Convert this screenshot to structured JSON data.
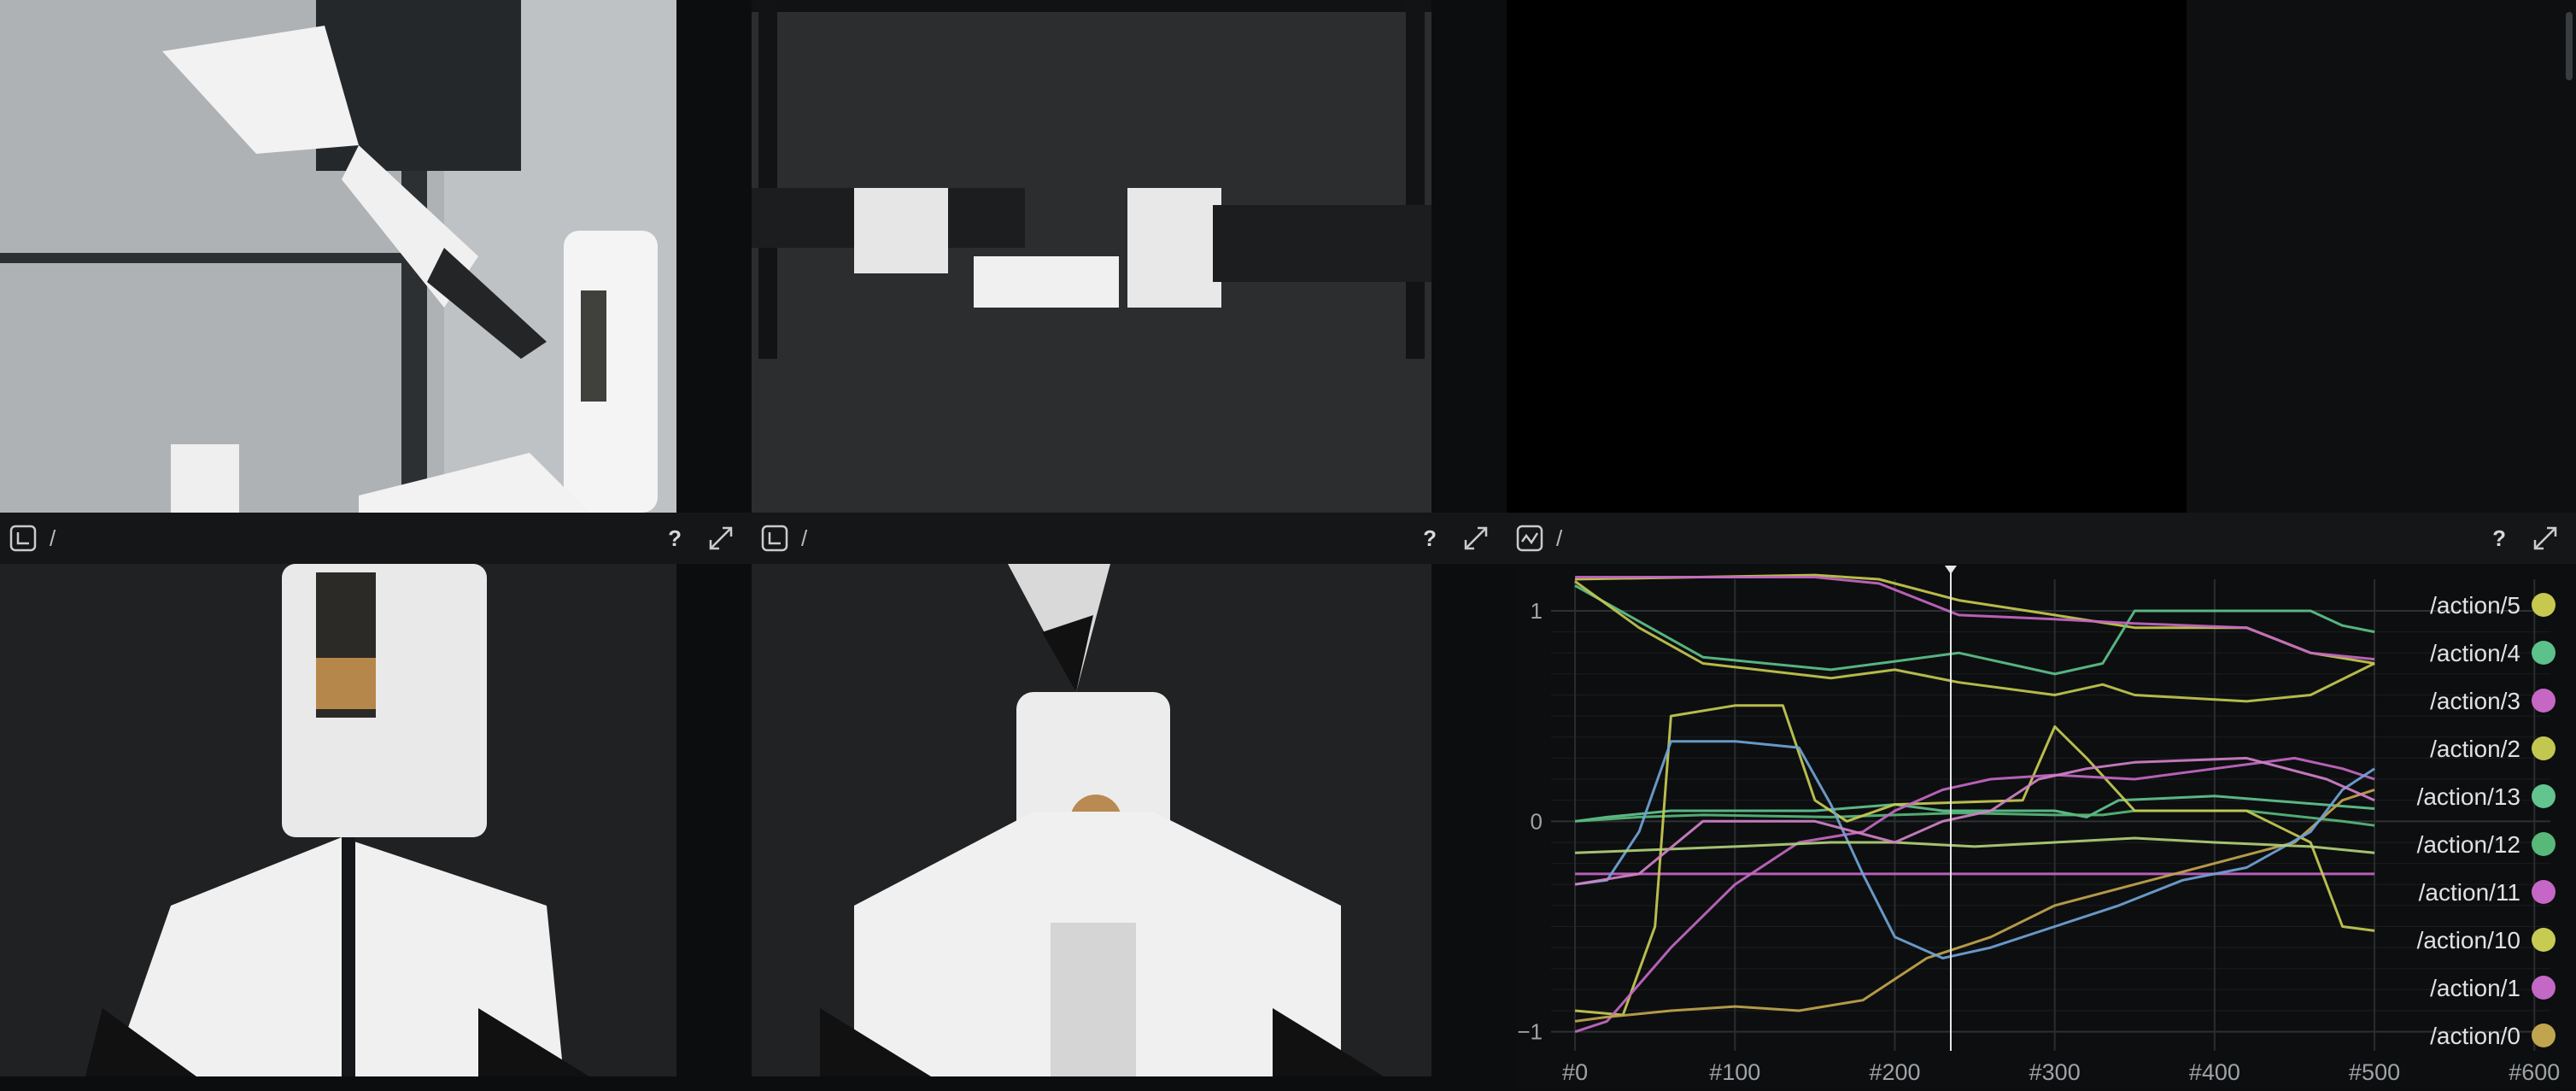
{
  "views": {
    "cam1": {
      "path": "/"
    },
    "cam2": {
      "path": "/"
    },
    "cam3": {
      "path": "/"
    },
    "plot": {
      "path": "/"
    },
    "help": "?"
  },
  "icons": {
    "space_view": "spatial-2d-icon",
    "plot_view": "timeseries-icon",
    "maximize": "maximize-icon"
  },
  "colors": {
    "background": "#0c0d0e",
    "panel_bar": "#141617",
    "plot_bg": "#0d0e0f",
    "time_cursor": "#e8e8e8"
  },
  "chart_data": {
    "type": "line",
    "title": "",
    "xlabel": "",
    "ylabel": "",
    "xlim": [
      -15,
      610
    ],
    "ylim": [
      -1.05,
      1.15
    ],
    "x_ticks": [
      "#0",
      "#100",
      "#200",
      "#300",
      "#400",
      "#500",
      "#600"
    ],
    "x_tick_values": [
      0,
      100,
      200,
      300,
      400,
      500,
      600
    ],
    "y_ticks": [
      "1",
      "0",
      "−1"
    ],
    "y_tick_values": [
      1,
      0,
      -1
    ],
    "time_cursor": 235,
    "grid": true,
    "legend_position": "right",
    "series": [
      {
        "name": "/action/5",
        "color": "#c6c94e",
        "x": [
          0,
          150,
          190,
          240,
          300,
          350,
          420,
          460,
          500
        ],
        "y": [
          1.15,
          1.17,
          1.15,
          1.05,
          0.98,
          0.92,
          0.92,
          0.8,
          0.75
        ]
      },
      {
        "name": "/action/4",
        "color": "#5cc18a",
        "x": [
          0,
          40,
          80,
          160,
          200,
          240,
          300,
          330,
          350,
          460,
          480,
          500
        ],
        "y": [
          1.12,
          0.95,
          0.78,
          0.72,
          0.76,
          0.8,
          0.7,
          0.75,
          1.0,
          1.0,
          0.93,
          0.9
        ]
      },
      {
        "name": "/action/3",
        "color": "#c667c4",
        "x": [
          0,
          150,
          190,
          240,
          300,
          350,
          420,
          460,
          500
        ],
        "y": [
          1.16,
          1.16,
          1.13,
          0.98,
          0.96,
          0.94,
          0.92,
          0.8,
          0.77
        ]
      },
      {
        "name": "/action/2",
        "color": "#c2c84f",
        "x": [
          0,
          40,
          80,
          160,
          200,
          240,
          300,
          330,
          350,
          420,
          460,
          500
        ],
        "y": [
          1.14,
          0.92,
          0.75,
          0.68,
          0.72,
          0.66,
          0.6,
          0.65,
          0.6,
          0.57,
          0.6,
          0.75
        ]
      },
      {
        "name": "/action/13",
        "color": "#62c48f",
        "x": [
          0,
          20,
          60,
          150,
          200,
          230,
          260,
          300,
          320,
          340,
          400,
          500
        ],
        "y": [
          0.0,
          0.02,
          0.05,
          0.05,
          0.08,
          0.05,
          0.05,
          0.05,
          0.02,
          0.1,
          0.12,
          0.06
        ]
      },
      {
        "name": "/action/12",
        "color": "#57b87a",
        "x": [
          0,
          40,
          80,
          160,
          200,
          240,
          300,
          330,
          350,
          420,
          480,
          500
        ],
        "y": [
          0.0,
          0.02,
          0.03,
          0.02,
          0.03,
          0.04,
          0.03,
          0.03,
          0.05,
          0.05,
          0.0,
          -0.02
        ]
      },
      {
        "name": "/action/11",
        "color": "#c666c6",
        "x": [
          0,
          100,
          200,
          300,
          400,
          500
        ],
        "y": [
          -0.25,
          -0.25,
          -0.25,
          -0.25,
          -0.25,
          -0.25
        ]
      },
      {
        "name": "/action/10",
        "color": "#c7cb52",
        "x": [
          0,
          30,
          50,
          60,
          100,
          130,
          150,
          170,
          200,
          280,
          300,
          320,
          350,
          420,
          460,
          480,
          500
        ],
        "y": [
          -0.9,
          -0.92,
          -0.5,
          0.5,
          0.55,
          0.55,
          0.1,
          0.0,
          0.08,
          0.1,
          0.45,
          0.3,
          0.05,
          0.05,
          -0.1,
          -0.5,
          -0.52
        ]
      },
      {
        "name": "/action/1",
        "color": "#c368c4",
        "x": [
          0,
          20,
          60,
          100,
          140,
          180,
          200,
          230,
          260,
          300,
          350,
          400,
          450,
          480,
          500
        ],
        "y": [
          -1.0,
          -0.95,
          -0.6,
          -0.3,
          -0.1,
          -0.05,
          0.05,
          0.15,
          0.2,
          0.22,
          0.2,
          0.25,
          0.3,
          0.25,
          0.2
        ]
      },
      {
        "name": "/action/0",
        "color": "#c1a54e",
        "x": [
          0,
          20,
          60,
          100,
          140,
          180,
          220,
          260,
          300,
          350,
          400,
          450,
          480,
          500
        ],
        "y": [
          -0.95,
          -0.93,
          -0.9,
          -0.88,
          -0.9,
          -0.85,
          -0.65,
          -0.55,
          -0.4,
          -0.3,
          -0.2,
          -0.1,
          0.1,
          0.15
        ]
      },
      {
        "name": "",
        "color": "#6fa4d6",
        "x": [
          0,
          20,
          40,
          60,
          100,
          140,
          160,
          180,
          200,
          230,
          260,
          300,
          340,
          380,
          420,
          460,
          480,
          500
        ],
        "y": [
          -0.3,
          -0.28,
          -0.05,
          0.38,
          0.38,
          0.35,
          0.08,
          -0.25,
          -0.55,
          -0.65,
          -0.6,
          -0.5,
          -0.4,
          -0.28,
          -0.22,
          -0.05,
          0.15,
          0.25
        ]
      },
      {
        "name": "",
        "color": "#b0d07a",
        "x": [
          0,
          100,
          160,
          200,
          250,
          300,
          350,
          400,
          460,
          500
        ],
        "y": [
          -0.15,
          -0.12,
          -0.1,
          -0.1,
          -0.12,
          -0.1,
          -0.08,
          -0.1,
          -0.12,
          -0.15
        ]
      },
      {
        "name": "",
        "color": "#d081c8",
        "x": [
          0,
          40,
          80,
          150,
          200,
          230,
          260,
          290,
          320,
          350,
          420,
          470,
          500
        ],
        "y": [
          -0.3,
          -0.25,
          0.0,
          0.0,
          -0.1,
          0.0,
          0.05,
          0.2,
          0.25,
          0.28,
          0.3,
          0.2,
          0.1
        ]
      }
    ]
  }
}
